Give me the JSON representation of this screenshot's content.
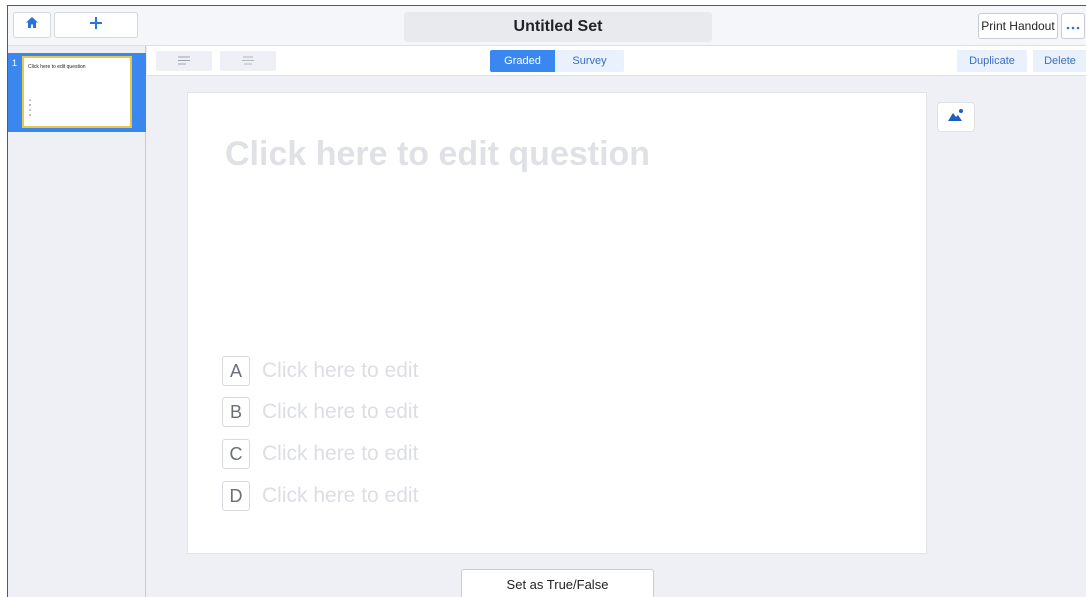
{
  "header": {
    "title": "Untitled Set",
    "print_label": "Print Handout",
    "more_label": "•••"
  },
  "sidebar": {
    "slides": [
      {
        "number": "1",
        "question": "Click here to edit question",
        "options": [
          "A",
          "B",
          "C",
          "D"
        ]
      }
    ]
  },
  "toolbar": {
    "modes": [
      "Graded",
      "Survey"
    ],
    "active_mode": "Graded",
    "duplicate_label": "Duplicate",
    "delete_label": "Delete"
  },
  "editor": {
    "question_placeholder": "Click here to edit question",
    "options": [
      {
        "letter": "A",
        "placeholder": "Click here to edit"
      },
      {
        "letter": "B",
        "placeholder": "Click here to edit"
      },
      {
        "letter": "C",
        "placeholder": "Click here to edit"
      },
      {
        "letter": "D",
        "placeholder": "Click here to edit"
      }
    ]
  },
  "footer": {
    "true_false_label": "Set as True/False"
  },
  "colors": {
    "accent": "#3a87f0",
    "thumb_border": "#e6c84a",
    "placeholder_text": "#dcdee4"
  },
  "icons": {
    "home": "home-icon",
    "add": "plus-icon",
    "more": "ellipsis-icon",
    "align_left": "align-left-icon",
    "align_center": "align-center-icon",
    "image": "image-icon"
  }
}
